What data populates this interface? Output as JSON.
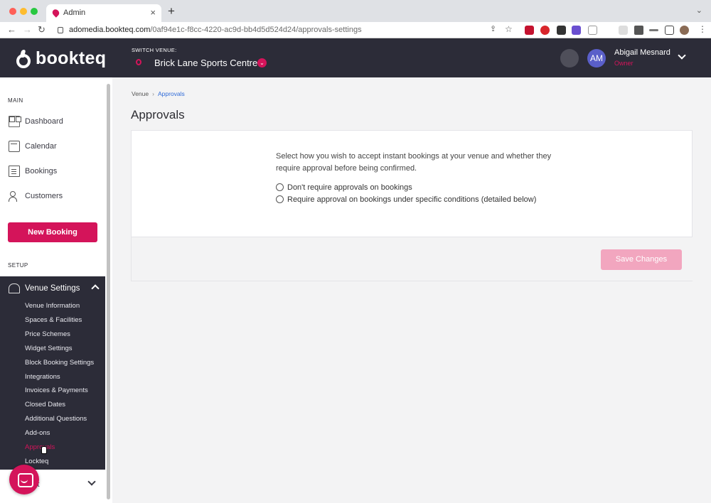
{
  "browser": {
    "tab_title": "Admin",
    "tab_close": "×",
    "new_tab": "+",
    "menu": "⌄",
    "url_host": "adomedia.bookteq.com",
    "url_path": "/0af94e1c-f8cc-4220-ac9d-bb4d5d524d24/approvals-settings"
  },
  "header": {
    "logo_text": "bookteq",
    "switch_venue_label": "SWITCH VENUE:",
    "venue_name": "Brick Lane Sports Centre",
    "user_initials": "AM",
    "user_name": "Abigail Mesnard",
    "user_role": "Owner",
    "brand_color": "#d4145a",
    "header_bg": "#2c2c38"
  },
  "sidebar": {
    "main_label": "MAIN",
    "items": [
      {
        "label": "Dashboard",
        "icon": "dashboard-icon"
      },
      {
        "label": "Calendar",
        "icon": "calendar-icon"
      },
      {
        "label": "Bookings",
        "icon": "bookings-icon"
      },
      {
        "label": "Customers",
        "icon": "customers-icon"
      }
    ],
    "new_booking_label": "New Booking",
    "setup_label": "SETUP",
    "venue_settings_label": "Venue Settings",
    "sub_items": [
      "Venue Information",
      "Spaces & Facilities",
      "Price Schemes",
      "Widget Settings",
      "Block Booking Settings",
      "Integrations",
      "Invoices & Payments",
      "Closed Dates",
      "Additional Questions",
      "Add-ons",
      "Approvals",
      "Lockteq"
    ],
    "active_sub_item": "Approvals",
    "account_label": "ount"
  },
  "main": {
    "breadcrumb": {
      "root": "Venue",
      "sep": "›",
      "current": "Approvals"
    },
    "title": "Approvals",
    "intro": "Select how you wish to accept instant bookings at your venue and whether they require approval before being confirmed.",
    "options": [
      "Don't require approvals on bookings",
      "Require approval on bookings under specific conditions (detailed below)"
    ],
    "save_label": "Save Changes"
  }
}
